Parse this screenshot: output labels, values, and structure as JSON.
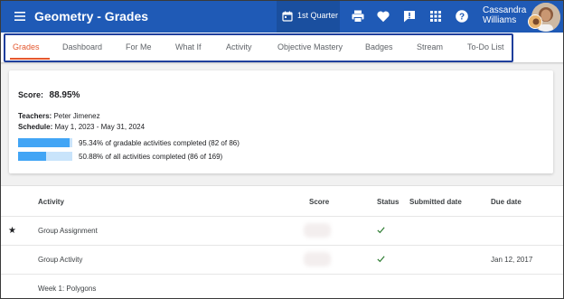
{
  "header": {
    "title": "Geometry - Grades",
    "quarter_label": "1st Quarter",
    "user_name": "Cassandra Williams",
    "icons": [
      "menu-icon",
      "calendar-icon",
      "print-icon",
      "heart-icon",
      "alert-icon",
      "apps-icon",
      "help-icon",
      "avatar"
    ]
  },
  "tabs": [
    {
      "label": "Grades",
      "active": true
    },
    {
      "label": "Dashboard",
      "active": false
    },
    {
      "label": "For Me",
      "active": false
    },
    {
      "label": "What If",
      "active": false
    },
    {
      "label": "Activity",
      "active": false
    },
    {
      "label": "Objective Mastery",
      "active": false
    },
    {
      "label": "Badges",
      "active": false
    },
    {
      "label": "Stream",
      "active": false
    },
    {
      "label": "To-Do List",
      "active": false
    }
  ],
  "summary": {
    "score_label": "Score:",
    "score_value": "88.95%",
    "teachers_label": "Teachers:",
    "teachers_value": "Peter Jimenez",
    "schedule_label": "Schedule:",
    "schedule_value": "May 1, 2023 - May 31, 2024",
    "progress": [
      {
        "percent": 95.34,
        "text": "95.34% of gradable activities completed (82 of 86)"
      },
      {
        "percent": 50.88,
        "text": "50.88% of all activities completed (86 of 169)"
      }
    ]
  },
  "table": {
    "columns": [
      "Activity",
      "Score",
      "Status",
      "Submitted date",
      "Due date"
    ],
    "rows": [
      {
        "starred": true,
        "activity": "Group Assignment",
        "status": "complete",
        "submitted": "",
        "due": ""
      },
      {
        "starred": false,
        "activity": "Group Activity",
        "status": "complete",
        "submitted": "",
        "due": "Jan 12, 2017"
      },
      {
        "starred": false,
        "activity": "Week 1: Polygons",
        "status": "",
        "submitted": "",
        "due": ""
      }
    ]
  },
  "colors": {
    "appbar": "#1f5ab6",
    "accent": "#e4572e",
    "progress_fill": "#42a5f5",
    "progress_track": "#c9e4fb",
    "check": "#2e7d32",
    "highlight_box": "#1f3f9c"
  }
}
